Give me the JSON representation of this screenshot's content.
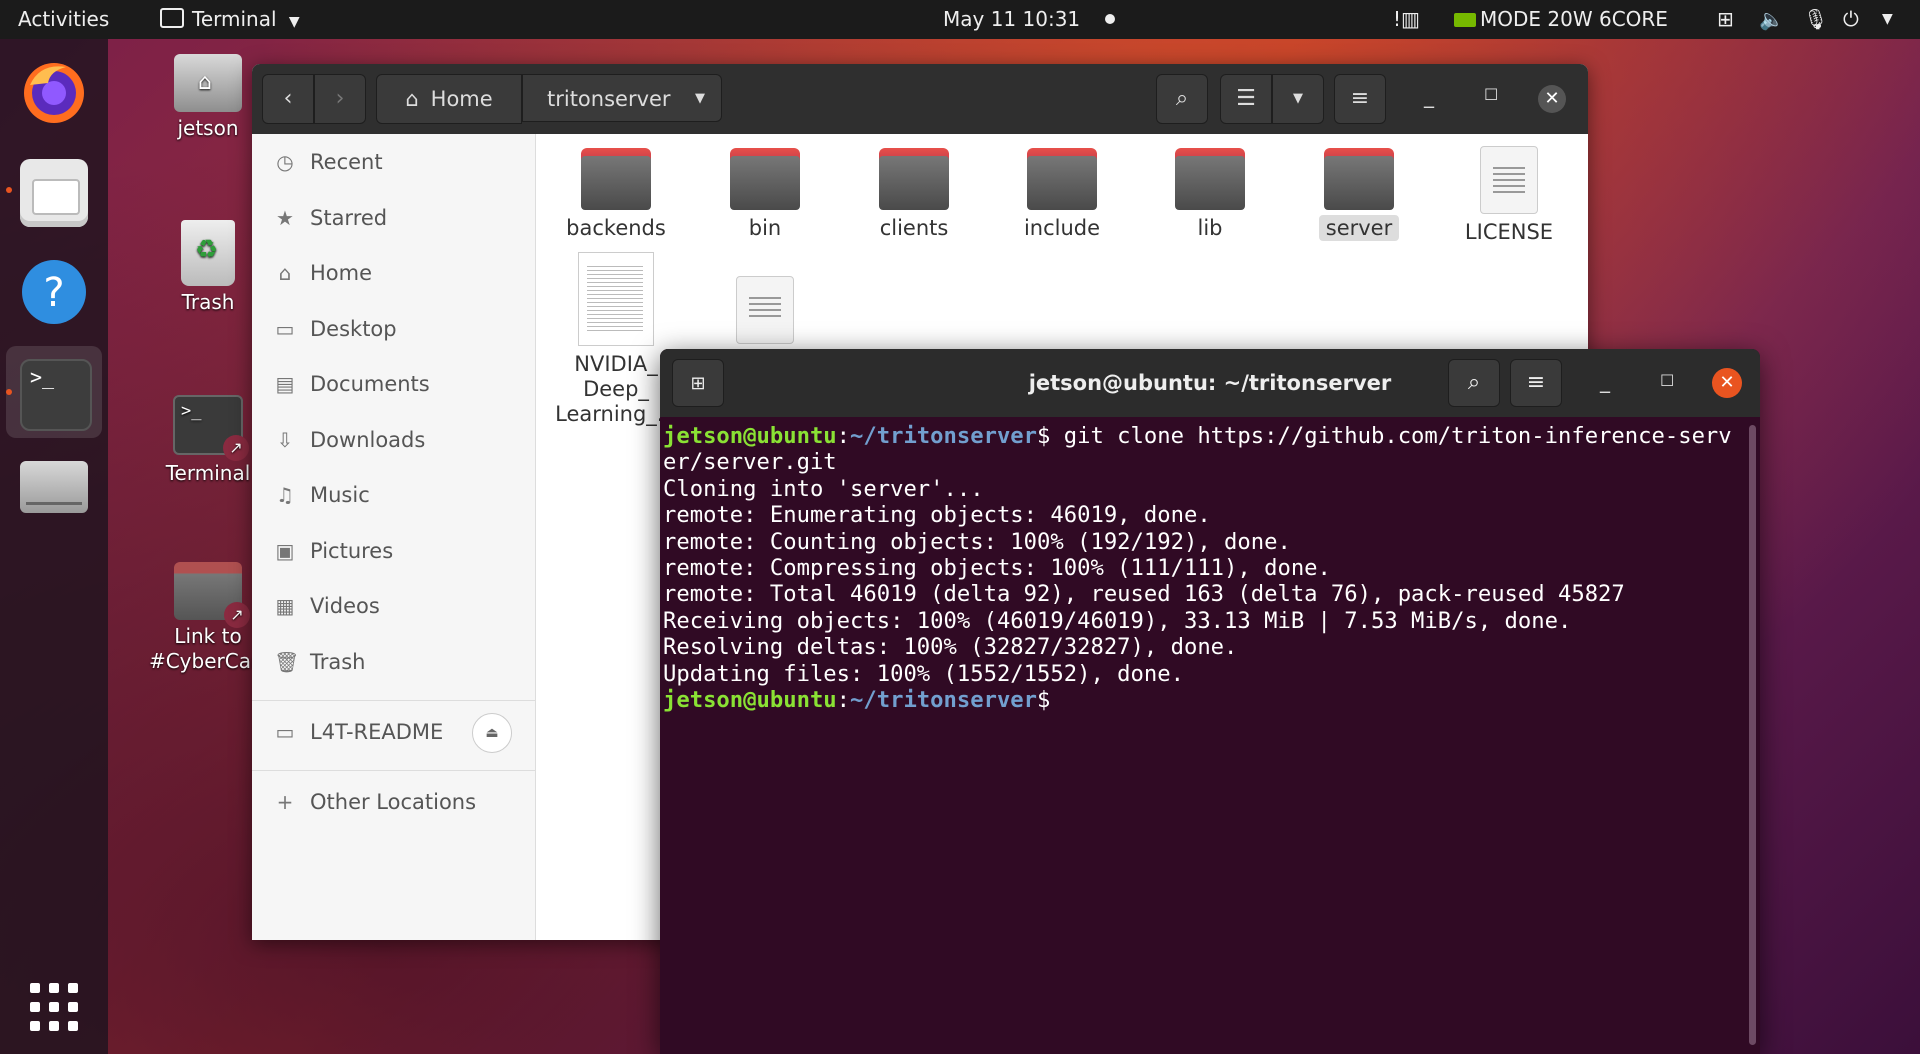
{
  "topbar": {
    "activities": "Activities",
    "app_menu": "Terminal",
    "clock": "May 11  10:31",
    "nvidia_mode": "MODE 20W 6CORE"
  },
  "desktop": {
    "home_label": "jetson",
    "trash_label": "Trash",
    "terminal_label": "Terminal",
    "link_label_1": "Link to",
    "link_label_2": "#CyberCart"
  },
  "files": {
    "breadcrumb_home": "Home",
    "breadcrumb_current": "tritonserver",
    "sidebar": [
      {
        "label": "Recent"
      },
      {
        "label": "Starred"
      },
      {
        "label": "Home"
      },
      {
        "label": "Desktop"
      },
      {
        "label": "Documents"
      },
      {
        "label": "Downloads"
      },
      {
        "label": "Music"
      },
      {
        "label": "Pictures"
      },
      {
        "label": "Videos"
      },
      {
        "label": "Trash"
      }
    ],
    "device": "L4T-README",
    "other_locations": "Other Locations",
    "items": [
      {
        "name": "backends"
      },
      {
        "name": "bin"
      },
      {
        "name": "clients"
      },
      {
        "name": "include"
      },
      {
        "name": "lib"
      },
      {
        "name": "server"
      },
      {
        "name": "LICENSE"
      }
    ],
    "pdf_name_1": "NVIDIA_",
    "pdf_name_2": "Deep_",
    "pdf_name_3": "Learning_..."
  },
  "terminal": {
    "title": "jetson@ubuntu: ~/tritonserver",
    "prompt_user": "jetson@ubuntu",
    "prompt_path": "~/tritonserver",
    "command_line_1": "$ git clone https://github.com/triton-inference-serv",
    "lines": [
      "er/server.git",
      "Cloning into 'server'...",
      "remote: Enumerating objects: 46019, done.",
      "remote: Counting objects: 100% (192/192), done.",
      "remote: Compressing objects: 100% (111/111), done.",
      "remote: Total 46019 (delta 92), reused 163 (delta 76), pack-reused 45827",
      "Receiving objects: 100% (46019/46019), 33.13 MiB | 7.53 MiB/s, done.",
      "Resolving deltas: 100% (32827/32827), done.",
      "Updating files: 100% (1552/1552), done."
    ],
    "prompt_end": "$"
  }
}
